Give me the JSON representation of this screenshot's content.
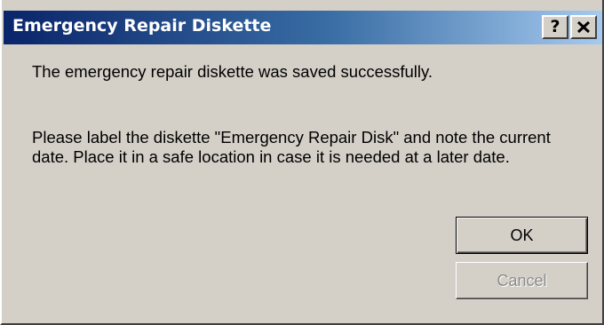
{
  "window": {
    "title": "Emergency Repair Diskette",
    "help_glyph": "?",
    "close_icon": "close-icon"
  },
  "message": {
    "line1": "The emergency repair diskette was saved successfully.",
    "line2": "Please label the diskette \"Emergency Repair Disk\" and note the current date. Place it in a safe location in case it is needed at a later date."
  },
  "buttons": {
    "ok_label": "OK",
    "cancel_label": "Cancel",
    "cancel_enabled": false
  },
  "colors": {
    "titlebar_start": "#0a246a",
    "titlebar_end": "#a6caf0",
    "face": "#d4d0c8",
    "disabled_text": "#8c8c8c"
  }
}
